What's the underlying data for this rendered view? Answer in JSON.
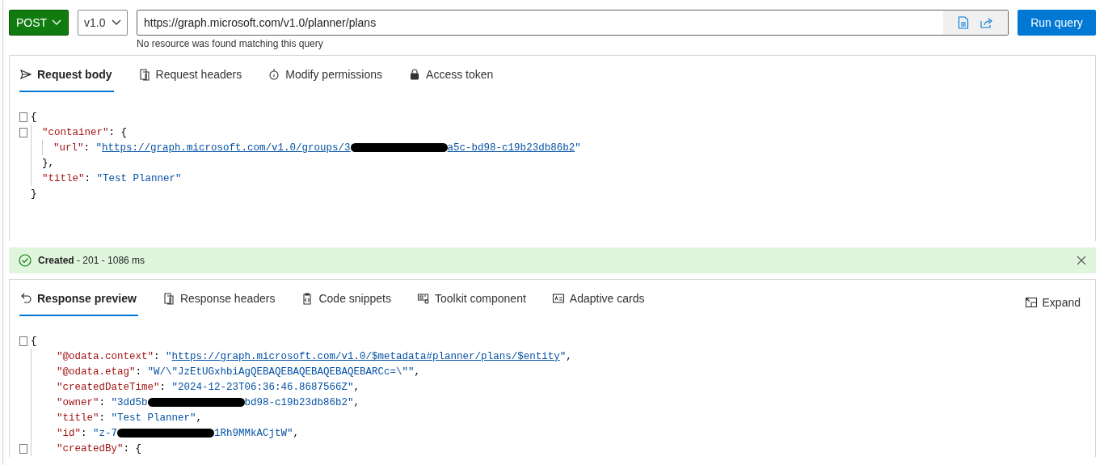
{
  "query_bar": {
    "method": "POST",
    "version": "v1.0",
    "url": "https://graph.microsoft.com/v1.0/planner/plans",
    "hint": "No resource was found matching this query",
    "run_button": "Run query"
  },
  "request": {
    "tabs": [
      {
        "label": "Request body",
        "selected": true
      },
      {
        "label": "Request headers",
        "selected": false
      },
      {
        "label": "Modify permissions",
        "selected": false
      },
      {
        "label": "Access token",
        "selected": false
      }
    ],
    "lines": [
      {
        "fold": true,
        "tokens": [
          {
            "kind": "punct",
            "text": "{"
          }
        ],
        "children": [
          {
            "fold": true,
            "tokens": [
              {
                "kind": "key",
                "text": "\"container\""
              },
              {
                "kind": "punct",
                "text": ": {"
              }
            ],
            "children": [
              {
                "fold": false,
                "tokens": [
                  {
                    "kind": "key",
                    "text": "\"url\""
                  },
                  {
                    "kind": "punct",
                    "text": ": "
                  },
                  {
                    "kind": "string",
                    "text": "\""
                  },
                  {
                    "kind": "link",
                    "text": "https://graph.microsoft.com/v1.0/groups/3"
                  },
                  {
                    "kind": "redaction"
                  },
                  {
                    "kind": "link",
                    "text": "a5c-bd98-c19b23db86b2"
                  },
                  {
                    "kind": "string",
                    "text": "\""
                  }
                ]
              }
            ]
          },
          {
            "fold": false,
            "tokens": [
              {
                "kind": "punct",
                "text": "},"
              }
            ]
          },
          {
            "fold": false,
            "tokens": [
              {
                "kind": "key",
                "text": "\"title\""
              },
              {
                "kind": "punct",
                "text": ": "
              },
              {
                "kind": "string",
                "text": "\"Test Planner\""
              }
            ]
          }
        ]
      },
      {
        "fold": false,
        "tokens": [
          {
            "kind": "punct",
            "text": "}"
          }
        ]
      }
    ]
  },
  "status": {
    "title": "Created",
    "detail": "- 201 - 1086 ms"
  },
  "response": {
    "tabs": [
      {
        "label": "Response preview",
        "selected": true
      },
      {
        "label": "Response headers",
        "selected": false
      },
      {
        "label": "Code snippets",
        "selected": false
      },
      {
        "label": "Toolkit component",
        "selected": false
      },
      {
        "label": "Adaptive cards",
        "selected": false
      }
    ],
    "expand": "Expand",
    "lines": [
      {
        "fold": true,
        "tokens": [
          {
            "kind": "punct",
            "text": "{"
          }
        ],
        "children": [
          {
            "fold": false,
            "tokens": [
              {
                "kind": "key",
                "text": "\"@odata.context\""
              },
              {
                "kind": "punct",
                "text": ": "
              },
              {
                "kind": "string",
                "text": "\""
              },
              {
                "kind": "link",
                "text": "https://graph.microsoft.com/v1.0/$metadata#planner/plans/$entity"
              },
              {
                "kind": "string",
                "text": "\""
              },
              {
                "kind": "punct",
                "text": ","
              }
            ]
          },
          {
            "fold": false,
            "tokens": [
              {
                "kind": "key",
                "text": "\"@odata.etag\""
              },
              {
                "kind": "punct",
                "text": ": "
              },
              {
                "kind": "string",
                "text": "\"W/\\\"JzEtUGxhbiAgQEBAQEBAQEBAQEBAQEBARCc=\\\"\""
              },
              {
                "kind": "punct",
                "text": ","
              }
            ]
          },
          {
            "fold": false,
            "tokens": [
              {
                "kind": "key",
                "text": "\"createdDateTime\""
              },
              {
                "kind": "punct",
                "text": ": "
              },
              {
                "kind": "string",
                "text": "\"2024-12-23T06:36:46.8687566Z\""
              },
              {
                "kind": "punct",
                "text": ","
              }
            ]
          },
          {
            "fold": false,
            "tokens": [
              {
                "kind": "key",
                "text": "\"owner\""
              },
              {
                "kind": "punct",
                "text": ": "
              },
              {
                "kind": "string",
                "text": "\"3dd5b"
              },
              {
                "kind": "redaction"
              },
              {
                "kind": "string",
                "text": "bd98-c19b23db86b2\""
              },
              {
                "kind": "punct",
                "text": ","
              }
            ]
          },
          {
            "fold": false,
            "tokens": [
              {
                "kind": "key",
                "text": "\"title\""
              },
              {
                "kind": "punct",
                "text": ": "
              },
              {
                "kind": "string",
                "text": "\"Test Planner\""
              },
              {
                "kind": "punct",
                "text": ","
              }
            ]
          },
          {
            "fold": false,
            "tokens": [
              {
                "kind": "key",
                "text": "\"id\""
              },
              {
                "kind": "punct",
                "text": ": "
              },
              {
                "kind": "string",
                "text": "\"z-7"
              },
              {
                "kind": "redaction"
              },
              {
                "kind": "string",
                "text": "1Rh9MMkACjtW\""
              },
              {
                "kind": "punct",
                "text": ","
              }
            ]
          },
          {
            "fold": true,
            "tokens": [
              {
                "kind": "key",
                "text": "\"createdBy\""
              },
              {
                "kind": "punct",
                "text": ": {"
              }
            ]
          }
        ]
      }
    ]
  }
}
